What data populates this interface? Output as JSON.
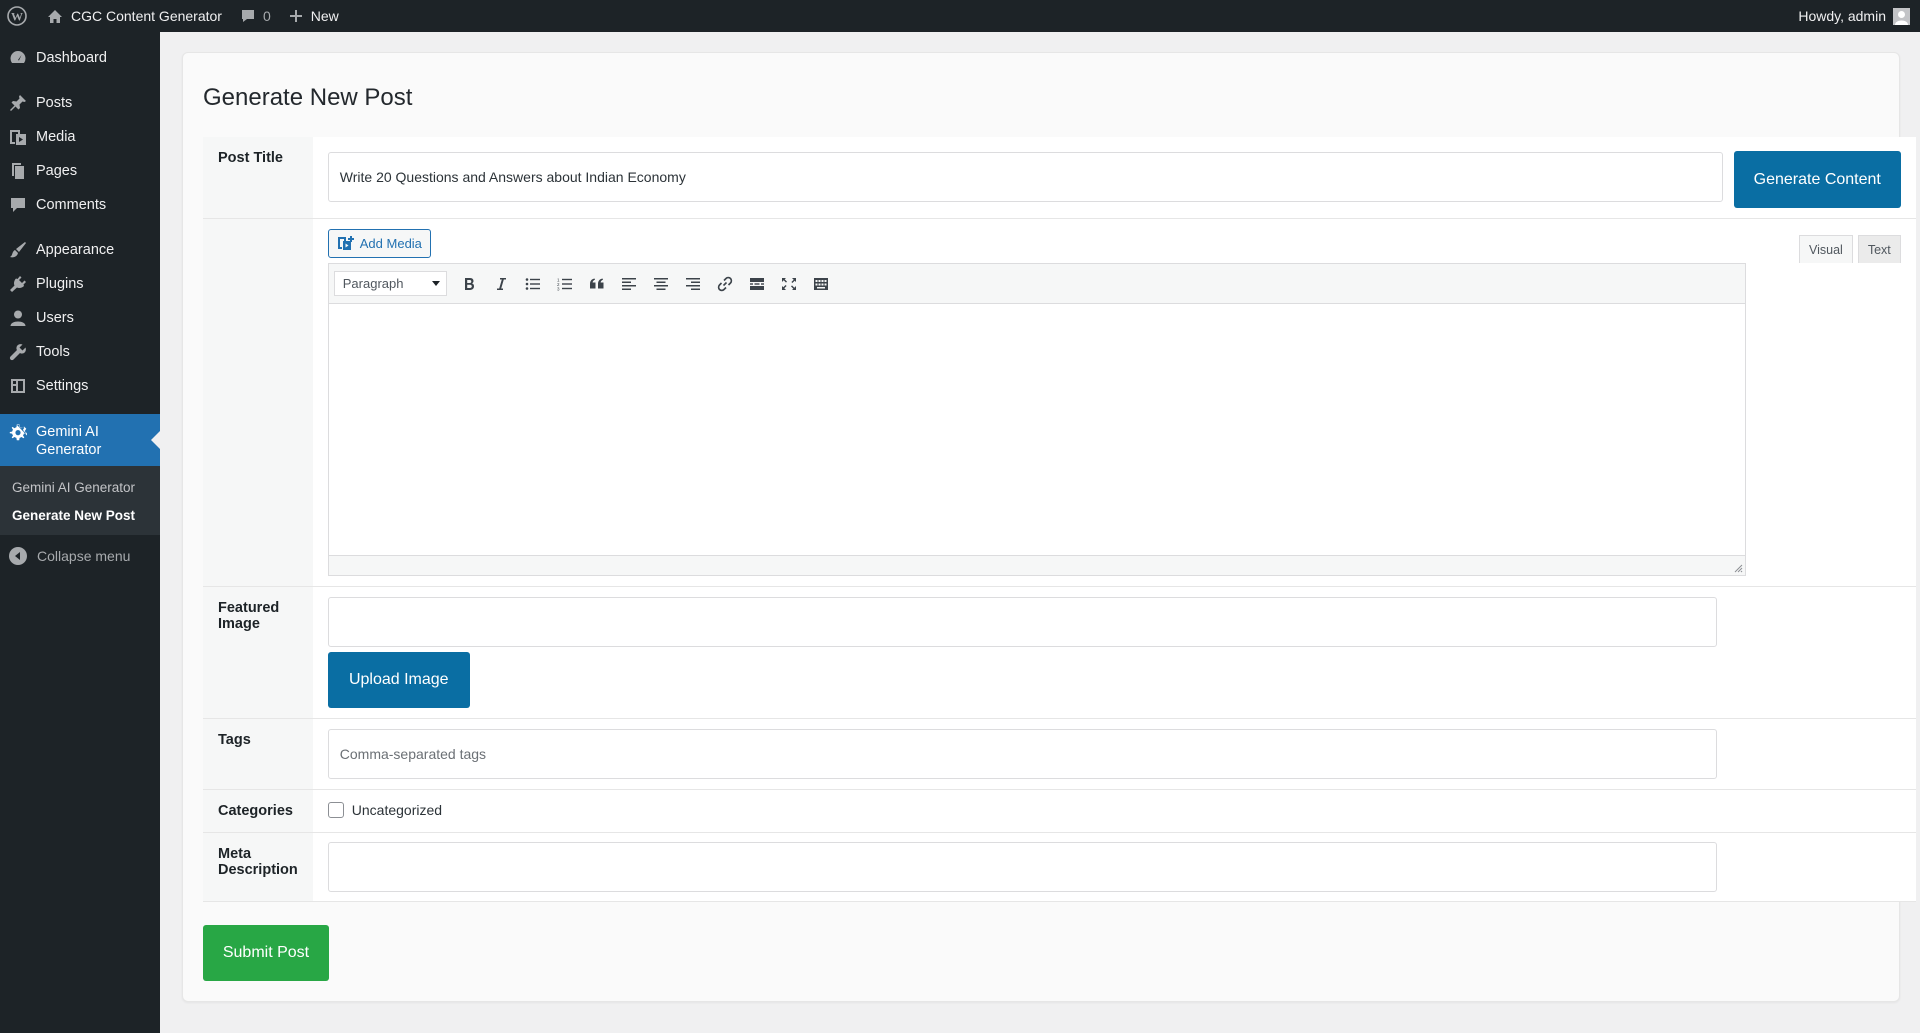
{
  "adminbar": {
    "site_name": "CGC Content Generator",
    "comments_count": "0",
    "new_label": "New",
    "howdy": "Howdy, admin"
  },
  "sidebar": {
    "items": [
      {
        "label": "Dashboard",
        "icon": "dashboard-icon"
      },
      {
        "label": "Posts",
        "icon": "pin-icon"
      },
      {
        "label": "Media",
        "icon": "media-icon"
      },
      {
        "label": "Pages",
        "icon": "pages-icon"
      },
      {
        "label": "Comments",
        "icon": "comment-icon"
      },
      {
        "label": "Appearance",
        "icon": "brush-icon"
      },
      {
        "label": "Plugins",
        "icon": "plugin-icon"
      },
      {
        "label": "Users",
        "icon": "user-icon"
      },
      {
        "label": "Tools",
        "icon": "wrench-icon"
      },
      {
        "label": "Settings",
        "icon": "settings-icon"
      }
    ],
    "current": {
      "label_line1": "Gemini AI",
      "label_line2": "Generator",
      "icon": "gear-icon"
    },
    "submenu": [
      "Gemini AI Generator",
      "Generate New Post"
    ],
    "collapse_label": "Collapse menu"
  },
  "page": {
    "title": "Generate New Post"
  },
  "form": {
    "post_title_label": "Post Title",
    "post_title_value": "Write 20 Questions and Answers about Indian Economy",
    "generate_button": "Generate Content",
    "add_media": "Add Media",
    "tab_visual": "Visual",
    "tab_text": "Text",
    "format_select": "Paragraph",
    "featured_image_label": "Featured Image",
    "upload_button": "Upload Image",
    "tags_label": "Tags",
    "tags_placeholder": "Comma-separated tags",
    "categories_label": "Categories",
    "category_option": "Uncategorized",
    "meta_label": "Meta Description",
    "submit_button": "Submit Post"
  },
  "colors": {
    "admin_dark": "#1d2327",
    "accent_blue": "#2271b1",
    "button_blue": "#0a6ea3",
    "submit_green": "#28a745"
  }
}
